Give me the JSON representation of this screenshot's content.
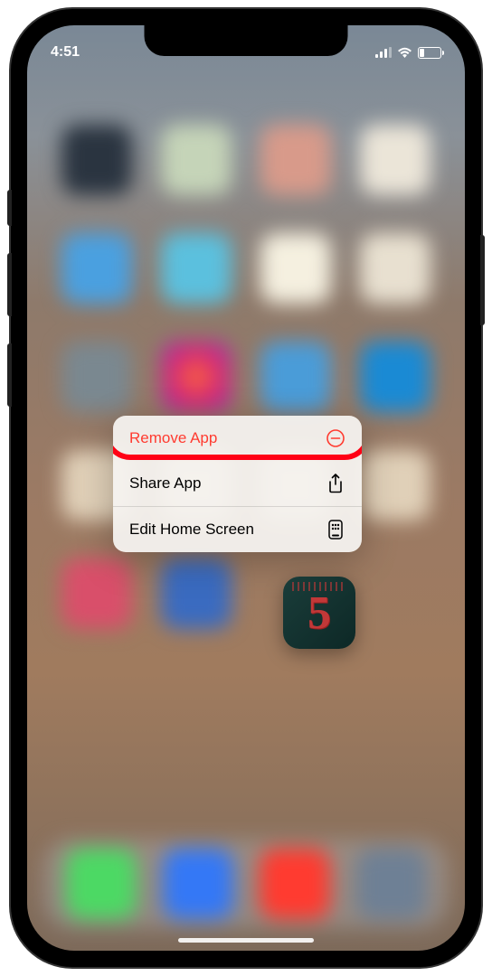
{
  "status_bar": {
    "time": "4:51"
  },
  "context_menu": {
    "items": [
      {
        "label": "Remove App",
        "icon": "minus-circle",
        "destructive": true,
        "highlighted": true
      },
      {
        "label": "Share App",
        "icon": "share",
        "destructive": false,
        "highlighted": false
      },
      {
        "label": "Edit Home Screen",
        "icon": "apps",
        "destructive": false,
        "highlighted": false
      }
    ]
  },
  "source_app": {
    "glyph": "5"
  }
}
